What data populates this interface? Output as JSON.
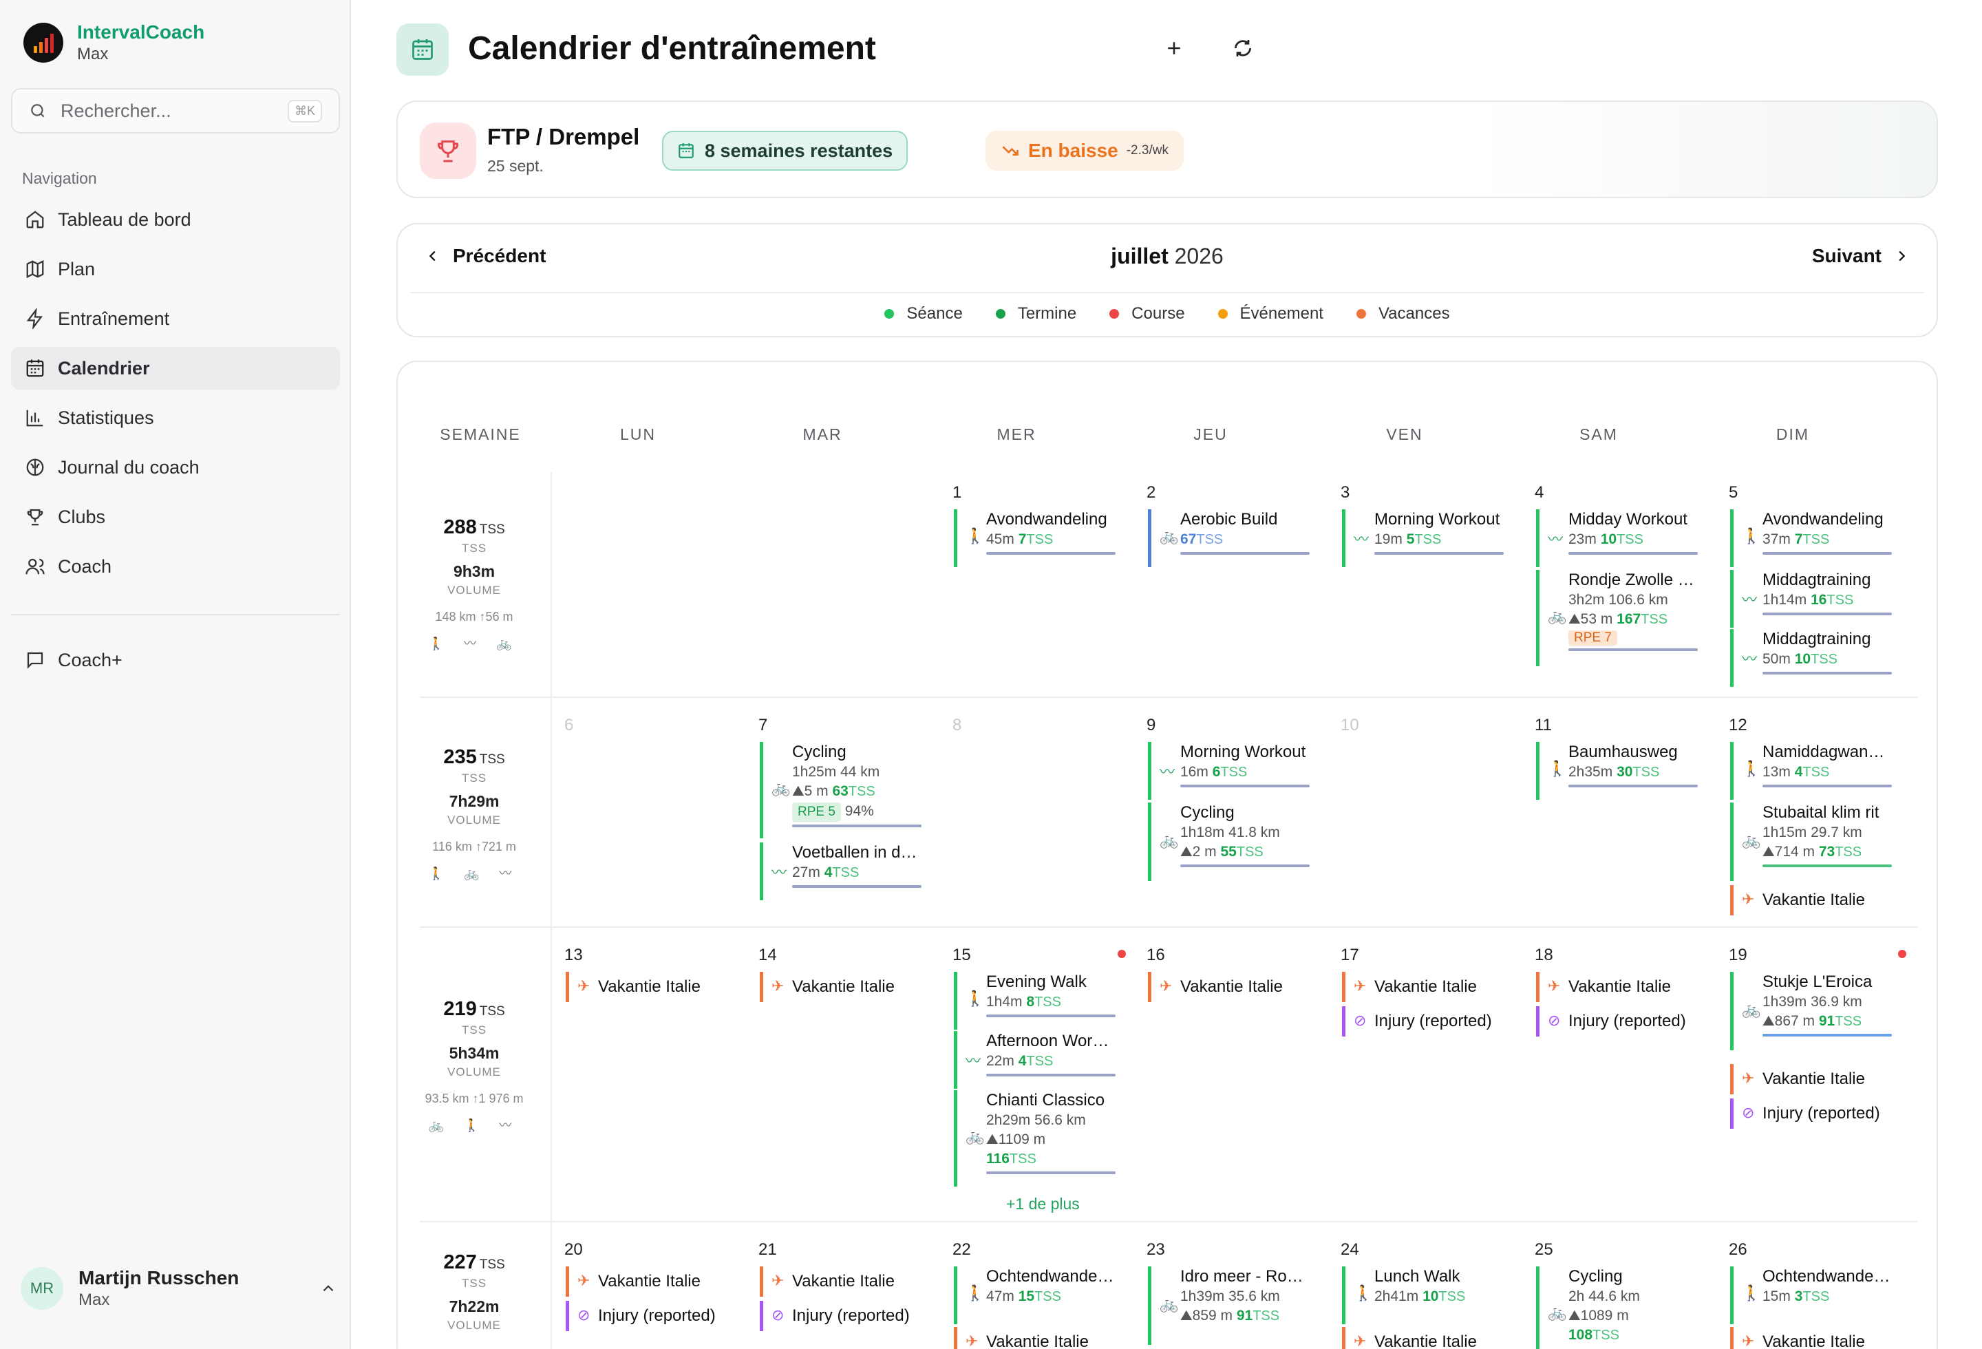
{
  "brand": {
    "name": "IntervalCoach",
    "sub": "Max"
  },
  "search": {
    "placeholder": "Rechercher...",
    "shortcut": "⌘K"
  },
  "nav": {
    "title": "Navigation",
    "items": [
      {
        "label": "Tableau de bord",
        "icon": "home-icon"
      },
      {
        "label": "Plan",
        "icon": "map-icon"
      },
      {
        "label": "Entraînement",
        "icon": "bolt-icon"
      },
      {
        "label": "Calendrier",
        "icon": "calendar-icon",
        "active": true
      },
      {
        "label": "Statistiques",
        "icon": "chart-icon"
      },
      {
        "label": "Journal du coach",
        "icon": "brain-icon"
      },
      {
        "label": "Clubs",
        "icon": "trophy-icon"
      },
      {
        "label": "Coach",
        "icon": "users-icon"
      }
    ],
    "coachplus": "Coach+"
  },
  "user": {
    "initials": "MR",
    "name": "Martijn Russchen",
    "sub": "Max"
  },
  "header": {
    "title": "Calendrier d'entraînement"
  },
  "goal": {
    "title": "FTP / Drempel",
    "date": "25 sept.",
    "weeks": "8 semaines restantes",
    "trend": "En baisse",
    "rate": "-2.3/wk"
  },
  "monthnav": {
    "prev": "Précédent",
    "month": "juillet",
    "year": "2026",
    "next": "Suivant"
  },
  "legend": [
    {
      "label": "Séance",
      "color": "#22c55e"
    },
    {
      "label": "Termine",
      "color": "#16a34a"
    },
    {
      "label": "Course",
      "color": "#ef4444"
    },
    {
      "label": "Événement",
      "color": "#f59e0b"
    },
    {
      "label": "Vacances",
      "color": "#f0743b"
    }
  ],
  "columns": [
    "SEMAINE",
    "LUN",
    "MAR",
    "MER",
    "JEU",
    "VEN",
    "SAM",
    "DIM"
  ],
  "weeks": [
    {
      "tss": "288",
      "tss_unit": "TSS",
      "tss_lbl": "TSS",
      "vol": "9h3m",
      "vol_lbl": "VOLUME",
      "dist": "148 km  ↑56 m",
      "icons": "🚶 〰 🚲"
    },
    {
      "tss": "235",
      "tss_unit": "TSS",
      "tss_lbl": "TSS",
      "vol": "7h29m",
      "vol_lbl": "VOLUME",
      "dist": "116 km  ↑721 m",
      "icons": "🚶 🚲 〰"
    },
    {
      "tss": "219",
      "tss_unit": "TSS",
      "tss_lbl": "TSS",
      "vol": "5h34m",
      "vol_lbl": "VOLUME",
      "dist": "93.5 km  ↑1 976 m",
      "icons": "🚲 🚶 〰"
    },
    {
      "tss": "227",
      "tss_unit": "TSS",
      "tss_lbl": "TSS",
      "vol": "7h22m",
      "vol_lbl": "VOLUME",
      "dist": "",
      "icons": ""
    }
  ],
  "days": {
    "d1": "1",
    "d2": "2",
    "d3": "3",
    "d4": "4",
    "d5": "5",
    "d6": "6",
    "d7": "7",
    "d8": "8",
    "d9": "9",
    "d10": "10",
    "d11": "11",
    "d12": "12",
    "d13": "13",
    "d14": "14",
    "d15": "15",
    "d16": "16",
    "d17": "17",
    "d18": "18",
    "d19": "19",
    "d20": "20",
    "d21": "21",
    "d22": "22",
    "d23": "23",
    "d24": "24",
    "d25": "25",
    "d26": "26"
  },
  "events": {
    "w1": {
      "avond1": {
        "name": "Avondwandeling",
        "dur": "45m",
        "tss": "7",
        "tssu": "TSS"
      },
      "aerobic": {
        "name": "Aerobic Build",
        "tss": "67",
        "tssu": "TSS"
      },
      "morning1": {
        "name": "Morning Workout",
        "dur": "19m",
        "tss": "5",
        "tssu": "TSS"
      },
      "midday": {
        "name": "Midday Workout",
        "dur": "23m",
        "tss": "10",
        "tssu": "TSS"
      },
      "rondje": {
        "name": "Rondje Zwolle en omgeving",
        "dur": "3h2m",
        "dist": "106.6 km",
        "elev": "53 m",
        "tss": "167",
        "tssu": "TSS",
        "rpe": "RPE 7"
      },
      "avond5": {
        "name": "Avondwandeling",
        "dur": "37m",
        "tss": "7",
        "tssu": "TSS"
      },
      "middag1": {
        "name": "Middagtraining",
        "dur": "1h14m",
        "tss": "16",
        "tssu": "TSS"
      },
      "middag2": {
        "name": "Middagtraining",
        "dur": "50m",
        "tss": "10",
        "tssu": "TSS"
      }
    },
    "w2": {
      "cycling7": {
        "name": "Cycling",
        "dur": "1h25m",
        "dist": "44 km",
        "elev": "5 m",
        "tss": "63",
        "tssu": "TSS",
        "rpe": "RPE 5",
        "pct": "94%"
      },
      "voetbal": {
        "name": "Voetballen in de middag",
        "dur": "27m",
        "tss": "4",
        "tssu": "TSS"
      },
      "morning9": {
        "name": "Morning Workout",
        "dur": "16m",
        "tss": "6",
        "tssu": "TSS"
      },
      "cycling9": {
        "name": "Cycling",
        "dur": "1h18m",
        "dist": "41.8 km",
        "elev": "2 m",
        "tss": "55",
        "tssu": "TSS"
      },
      "baum": {
        "name": "Baumhausweg",
        "dur": "2h35m",
        "tss": "30",
        "tssu": "TSS"
      },
      "namid": {
        "name": "Namiddagwandeling",
        "dur": "13m",
        "tss": "4",
        "tssu": "TSS"
      },
      "stubai": {
        "name": "Stubaital klim rit",
        "dur": "1h15m",
        "dist": "29.7 km",
        "elev": "714 m",
        "tss": "73",
        "tssu": "TSS"
      },
      "vak12": {
        "name": "Vakantie Italie"
      }
    },
    "w3": {
      "vak13": {
        "name": "Vakantie Italie"
      },
      "vak14": {
        "name": "Vakantie Italie"
      },
      "evening": {
        "name": "Evening Walk",
        "dur": "1h4m",
        "tss": "8",
        "tssu": "TSS"
      },
      "afternoon": {
        "name": "Afternoon Workout",
        "dur": "22m",
        "tss": "4",
        "tssu": "TSS"
      },
      "chianti": {
        "name": "Chianti Classico",
        "dur": "2h29m",
        "dist": "56.6 km",
        "elev": "1109 m",
        "tss": "116",
        "tssu": "TSS"
      },
      "more15": "+1 de plus",
      "vak16": {
        "name": "Vakantie Italie"
      },
      "vak17": {
        "name": "Vakantie Italie"
      },
      "inj17": {
        "name": "Injury (reported)"
      },
      "vak18": {
        "name": "Vakantie Italie"
      },
      "inj18": {
        "name": "Injury (reported)"
      },
      "eroica": {
        "name": "Stukje L'Eroica",
        "dur": "1h39m",
        "dist": "36.9 km",
        "elev": "867 m",
        "tss": "91",
        "tssu": "TSS"
      },
      "vak19": {
        "name": "Vakantie Italie"
      },
      "inj19": {
        "name": "Injury (reported)"
      }
    },
    "w4": {
      "vak20": {
        "name": "Vakantie Italie"
      },
      "inj20": {
        "name": "Injury (reported)"
      },
      "vak21": {
        "name": "Vakantie Italie"
      },
      "inj21": {
        "name": "Injury (reported)"
      },
      "ochtend22": {
        "name": "Ochtendwandeling",
        "dur": "47m",
        "tss": "15",
        "tssu": "TSS"
      },
      "vak22": {
        "name": "Vakantie Italie"
      },
      "idro": {
        "name": "Idro meer - Rondje",
        "dur": "1h39m",
        "dist": "35.6 km",
        "elev": "859 m",
        "tss": "91",
        "tssu": "TSS"
      },
      "lunch": {
        "name": "Lunch Walk",
        "dur": "2h41m",
        "tss": "10",
        "tssu": "TSS"
      },
      "vak24": {
        "name": "Vakantie Italie"
      },
      "cycling25": {
        "name": "Cycling",
        "dur": "2h",
        "dist": "44.6 km",
        "elev": "1089 m",
        "tss": "108",
        "tssu": "TSS"
      },
      "ochtend26": {
        "name": "Ochtendwandeling",
        "dur": "15m",
        "tss": "3",
        "tssu": "TSS"
      },
      "vak26": {
        "name": "Vakantie Italie"
      }
    }
  }
}
